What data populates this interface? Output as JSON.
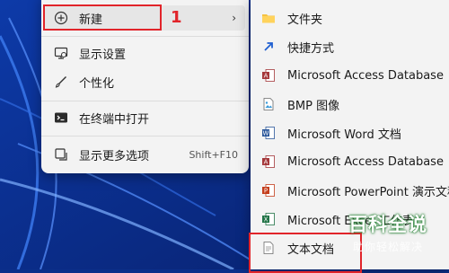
{
  "main_menu": {
    "items": [
      {
        "label": "新建"
      },
      {
        "label": "显示设置"
      },
      {
        "label": "个性化"
      },
      {
        "label": "在终端中打开"
      },
      {
        "label": "显示更多选项",
        "shortcut": "Shift+F10"
      }
    ]
  },
  "annotation": {
    "number": "1"
  },
  "submenu": {
    "items": [
      {
        "label": "文件夹"
      },
      {
        "label": "快捷方式"
      },
      {
        "label": "Microsoft Access Database"
      },
      {
        "label": "BMP 图像"
      },
      {
        "label": "Microsoft Word 文档"
      },
      {
        "label": "Microsoft Access Database"
      },
      {
        "label": "Microsoft PowerPoint 演示文稿"
      },
      {
        "label": "Microsoft Excel 工作表"
      },
      {
        "label": "文本文档"
      }
    ]
  },
  "watermark": {
    "title": "百科全说",
    "subtitle": "助你轻松解决"
  },
  "colors": {
    "accent_red": "#e1242a",
    "wallpaper_blue": "#0b2f8a",
    "menu_bg": "#f3f3f3"
  }
}
